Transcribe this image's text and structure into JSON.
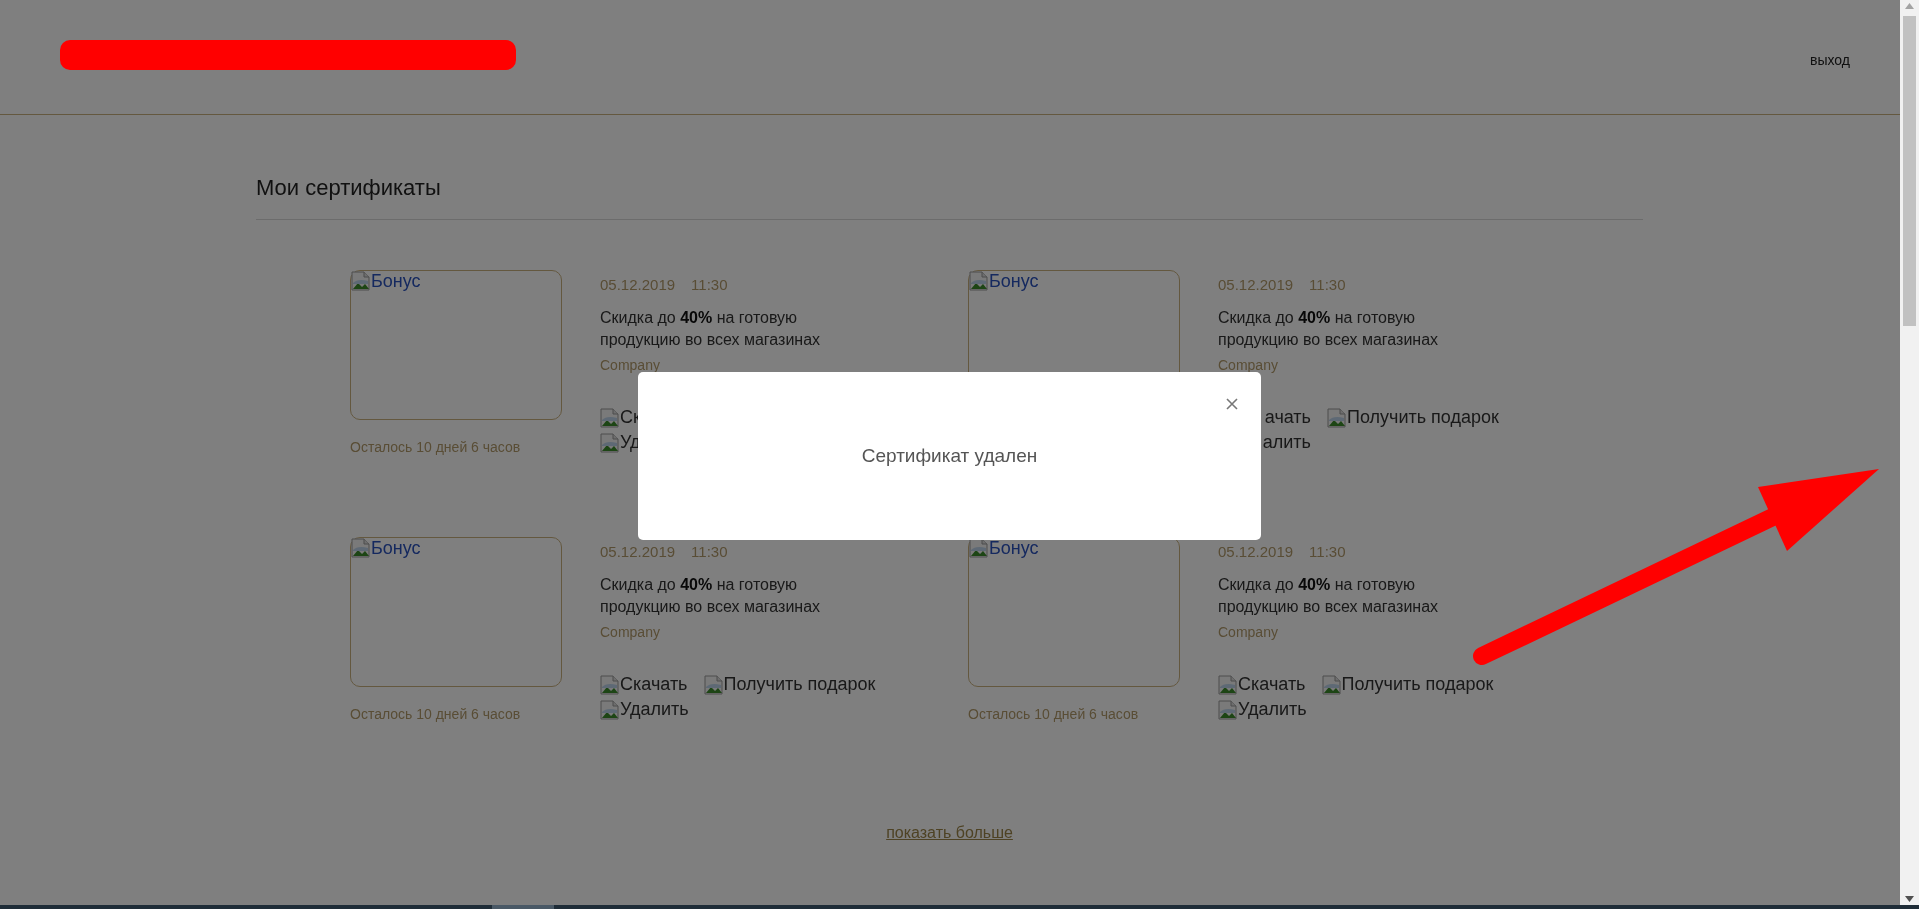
{
  "header": {
    "logout": "выход"
  },
  "page_title": "Мои сертификаты",
  "certificates": [
    {
      "image_alt": "Бонус",
      "date": "05.12.2019",
      "time": "11:30",
      "description": "Скидка до **40%** на готовую продукцию во всех магазинах",
      "company": "Company",
      "action_rows": [
        [
          {
            "label": "Ск",
            "cut": false
          }
        ],
        [
          {
            "label": "Уд",
            "cut": false
          }
        ]
      ],
      "remaining": "Осталось 10 дней 6 часов"
    },
    {
      "image_alt": "Бонус",
      "date": "05.12.2019",
      "time": "11:30",
      "description": "Скидка до **40%** на готовую продукцию во всех магазинах",
      "company": "Company",
      "action_rows": [
        [
          {
            "label": "ачать",
            "cut": true
          },
          {
            "label": "Получить подарок",
            "cut": false
          }
        ],
        [
          {
            "label": "алить",
            "cut": true
          }
        ]
      ]
    },
    {
      "image_alt": "Бонус",
      "date": "05.12.2019",
      "time": "11:30",
      "description": "Скидка до **40%** на готовую продукцию во всех магазинах",
      "company": "Company",
      "action_rows": [
        [
          {
            "label": "Скачать",
            "cut": false
          },
          {
            "label": "Получить подарок",
            "cut": false
          }
        ],
        [
          {
            "label": "Удалить",
            "cut": false
          }
        ]
      ],
      "remaining": "Осталось 10 дней 6 часов"
    },
    {
      "image_alt": "Бонус",
      "date": "05.12.2019",
      "time": "11:30",
      "description": "Скидка до **40%** на готовую продукцию во всех магазинах",
      "company": "Company",
      "action_rows": [
        [
          {
            "label": "Скачать",
            "cut": false
          },
          {
            "label": "Получить подарок",
            "cut": false
          }
        ],
        [
          {
            "label": "Удалить",
            "cut": false
          }
        ]
      ],
      "remaining": "Осталось 10 дней 6 часов"
    }
  ],
  "show_more": "показать больше",
  "modal": {
    "message": "Сертификат удален"
  }
}
